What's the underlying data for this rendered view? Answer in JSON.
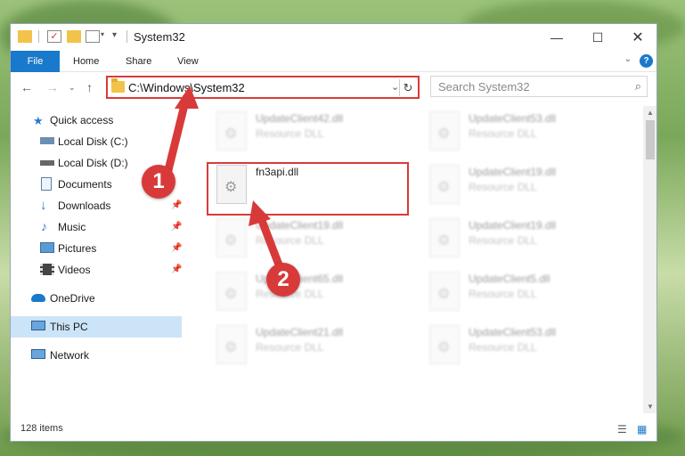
{
  "window": {
    "title": "System32"
  },
  "ribbon": {
    "file": "File",
    "tabs": [
      "Home",
      "Share",
      "View"
    ],
    "help": "?"
  },
  "address": {
    "path": "C:\\Windows\\System32"
  },
  "search": {
    "placeholder": "Search System32"
  },
  "sidebar": {
    "items": [
      {
        "label": "Quick access",
        "icon": "star-icon"
      },
      {
        "label": "Local Disk (C:)",
        "icon": "drive-icon"
      },
      {
        "label": "Local Disk (D:)",
        "icon": "drive-icon"
      },
      {
        "label": "Documents",
        "icon": "documents-icon"
      },
      {
        "label": "Downloads",
        "icon": "download-icon"
      },
      {
        "label": "Music",
        "icon": "music-icon"
      },
      {
        "label": "Pictures",
        "icon": "pictures-icon"
      },
      {
        "label": "Videos",
        "icon": "videos-icon"
      },
      {
        "label": "OneDrive",
        "icon": "cloud-icon"
      },
      {
        "label": "This PC",
        "icon": "computer-icon"
      },
      {
        "label": "Network",
        "icon": "network-icon"
      }
    ]
  },
  "files": [
    {
      "name": "UpdateClient42.dll",
      "desc": "Resource DLL"
    },
    {
      "name": "UpdateClient53.dll",
      "desc": "Resource DLL"
    },
    {
      "name": "fn3api.dll",
      "desc": ""
    },
    {
      "name": "UpdateClient19.dll",
      "desc": "Resource DLL"
    },
    {
      "name": "UpdateClient19.dll",
      "desc": "Resource DLL"
    },
    {
      "name": "UpdateClient19.dll",
      "desc": "Resource DLL"
    },
    {
      "name": "UpdateClient65.dll",
      "desc": "Resource DLL"
    },
    {
      "name": "UpdateClient5.dll",
      "desc": "Resource DLL"
    },
    {
      "name": "UpdateClient21.dll",
      "desc": "Resource DLL"
    },
    {
      "name": "UpdateClient53.dll",
      "desc": "Resource DLL"
    }
  ],
  "status": {
    "count": "128 items"
  },
  "callouts": [
    "1",
    "2"
  ],
  "colors": {
    "accent": "#1979ca",
    "highlight": "#d83a3a",
    "selected": "#cce4f7"
  }
}
